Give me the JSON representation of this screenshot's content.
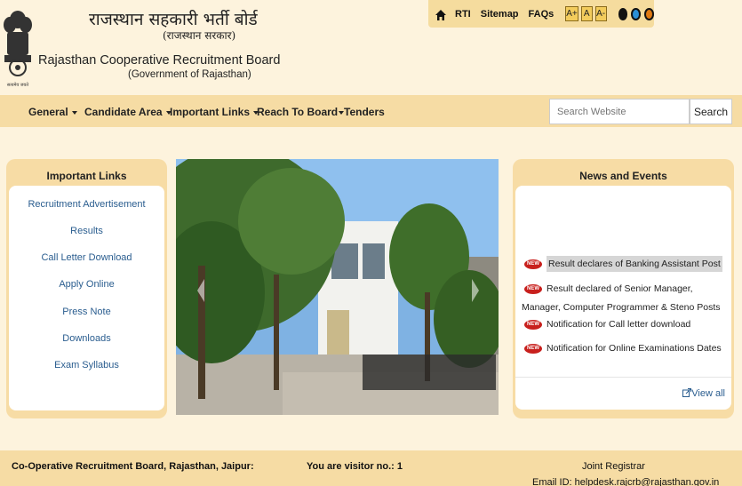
{
  "header": {
    "title_hi": "राजस्थान सहकारी भर्ती बोर्ड",
    "subtitle_hi": "(राजस्थान सरकार)",
    "title_en": "Rajasthan Cooperative Recruitment Board",
    "subtitle_en": "(Government of Rajasthan)",
    "emblem_caption": "सत्यमेव जयते"
  },
  "toplinks": {
    "rti": "RTI",
    "sitemap": "Sitemap",
    "faqs": "FAQs",
    "font_increase": "A+",
    "font_normal": "A",
    "font_decrease": "A-",
    "contrast_colors": [
      "#111111",
      "#2a8fd6",
      "#e07a12"
    ]
  },
  "nav": {
    "general": "General",
    "candidate_area": "Candidate Area",
    "important_links": "Important Links",
    "reach_to_board": "Reach To Board",
    "tenders": "Tenders"
  },
  "search": {
    "placeholder": "Search Website",
    "button": "Search"
  },
  "important_links": {
    "title": "Important Links",
    "items": [
      "Recruitment Advertisement",
      "Results",
      "Call Letter Download",
      "Apply Online",
      "Press Note",
      "Downloads",
      "Exam Syllabus"
    ]
  },
  "news": {
    "title": "News and Events",
    "badge": "NEW",
    "items": [
      "Result declares of Banking Assistant Post",
      "Result declared of Senior Manager, Manager, Computer Programmer & Steno Posts",
      "Notification for Call letter download",
      "Notification for Online Examinations Dates"
    ],
    "view_all": "View all"
  },
  "footer": {
    "left": "Co-Operative Recruitment Board, Rajasthan, Jaipur:",
    "visitor": "You are visitor no.: 1",
    "registrar": "Joint Registrar",
    "email": "Email ID: helpdesk.rajcrb@rajasthan.gov.in"
  },
  "colors": {
    "background": "#fdf3dd",
    "nav_bg": "#f6dca4",
    "link": "#2a5d8f",
    "badge": "#c8201d"
  }
}
